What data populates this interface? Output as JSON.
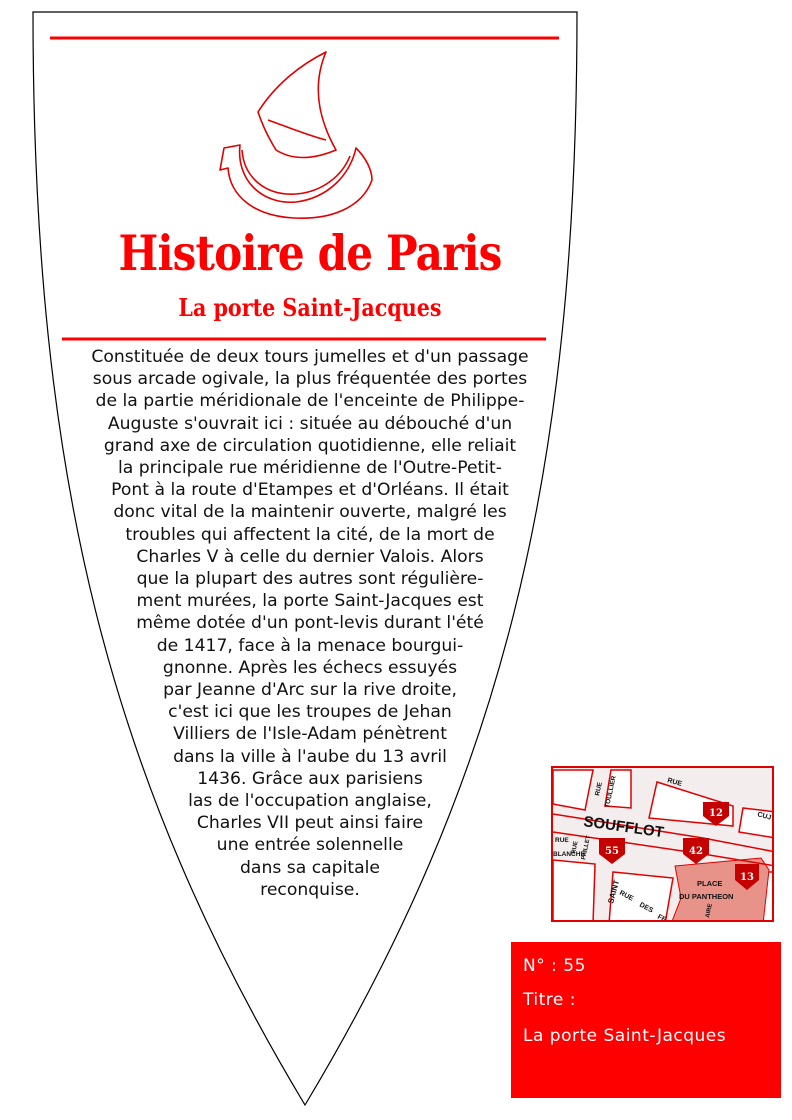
{
  "plaque": {
    "title": "Histoire de Paris",
    "subtitle": "La porte Saint-Jacques",
    "body_lines": [
      "Constituée de deux tours jumelles et d'un passage",
      "sous arcade ogivale, la plus fréquentée des portes",
      "de la partie méridionale de l'enceinte de Philippe-",
      "Auguste s'ouvrait ici : située au débouché d'un",
      "grand axe de circulation quotidienne, elle reliait",
      "la principale rue méridienne de l'Outre-Petit-",
      "Pont à la route d'Etampes et d'Orléans. Il était",
      "donc vital de la maintenir ouverte, malgré les",
      "troubles qui affectent la cité, de la mort de",
      "Charles V à celle du dernier Valois. Alors",
      "que la plupart des autres sont régulière-",
      "ment murées, la porte Saint-Jacques est",
      "même dotée d'un pont-levis durant l'été",
      "de 1417, face à la menace bourgui-",
      "gnonne. Après les échecs essuyés",
      "par Jeanne d'Arc sur la rive droite,",
      "c'est ici que les troupes de Jehan",
      "Villiers de l'Isle-Adam pénètrent",
      "dans la ville à l'aube du 13 avril",
      "1436. Grâce aux parisiens",
      "las de l'occupation anglaise,",
      "Charles VII peut ainsi faire",
      "une entrée solennelle",
      "dans sa capitale",
      "reconquise."
    ],
    "logo_icon": "paris-ship-logo-icon"
  },
  "map": {
    "labels": {
      "soufflot": "SOUFFLOT",
      "rue_top": "RUE",
      "toullier": "TOULLIER",
      "rue_toullier": "RUE",
      "cuj": "CUJ",
      "rue_left": "RUE",
      "paillet": "PAILLET",
      "rue_paillet": "RUE",
      "blanche": "BLANCHE",
      "saint": "SAINT",
      "rue_bottom": "RUE",
      "des": "DES",
      "fe": "FE",
      "aire": "AIRE",
      "place_1": "PLACE",
      "place_2": "DU PANTHEON"
    },
    "markers": [
      "12",
      "42",
      "55",
      "13"
    ],
    "colors": {
      "road_edge": "#e00000",
      "marker": "#c40000",
      "pantheon": "#e8938a",
      "background": "#f3eded"
    }
  },
  "info": {
    "number": "N° : 55",
    "title_label": "Titre :",
    "title_value": "La porte Saint-Jacques"
  },
  "colors": {
    "accent": "#ff0000"
  }
}
